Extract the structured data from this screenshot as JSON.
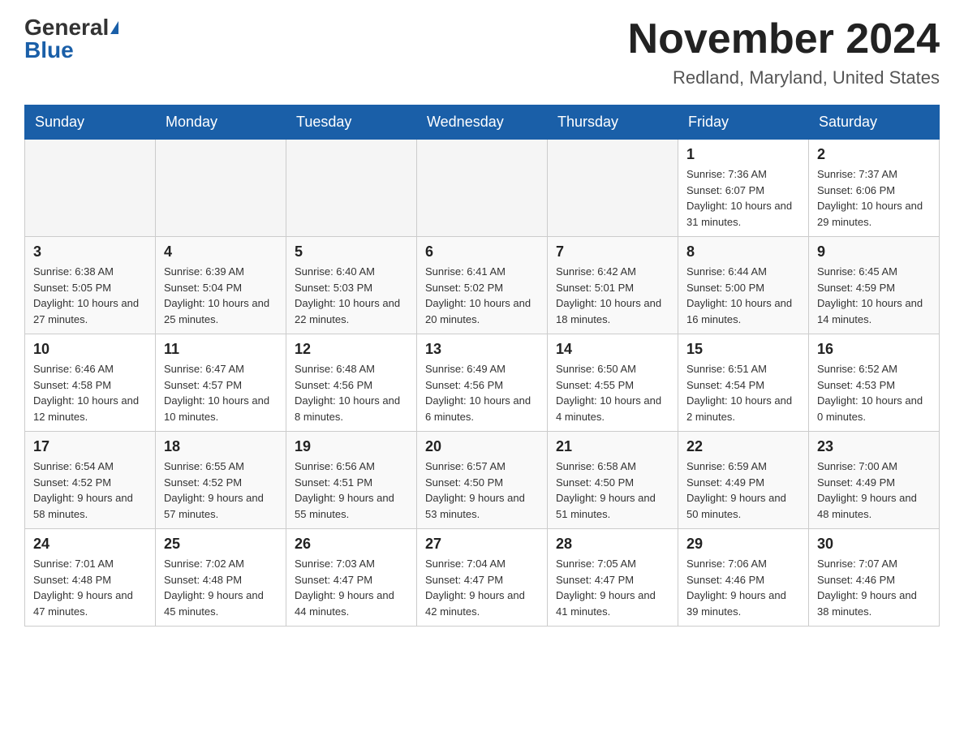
{
  "logo": {
    "general": "General",
    "blue": "Blue"
  },
  "title": "November 2024",
  "subtitle": "Redland, Maryland, United States",
  "days_of_week": [
    "Sunday",
    "Monday",
    "Tuesday",
    "Wednesday",
    "Thursday",
    "Friday",
    "Saturday"
  ],
  "weeks": [
    [
      {
        "day": "",
        "info": ""
      },
      {
        "day": "",
        "info": ""
      },
      {
        "day": "",
        "info": ""
      },
      {
        "day": "",
        "info": ""
      },
      {
        "day": "",
        "info": ""
      },
      {
        "day": "1",
        "info": "Sunrise: 7:36 AM\nSunset: 6:07 PM\nDaylight: 10 hours and 31 minutes."
      },
      {
        "day": "2",
        "info": "Sunrise: 7:37 AM\nSunset: 6:06 PM\nDaylight: 10 hours and 29 minutes."
      }
    ],
    [
      {
        "day": "3",
        "info": "Sunrise: 6:38 AM\nSunset: 5:05 PM\nDaylight: 10 hours and 27 minutes."
      },
      {
        "day": "4",
        "info": "Sunrise: 6:39 AM\nSunset: 5:04 PM\nDaylight: 10 hours and 25 minutes."
      },
      {
        "day": "5",
        "info": "Sunrise: 6:40 AM\nSunset: 5:03 PM\nDaylight: 10 hours and 22 minutes."
      },
      {
        "day": "6",
        "info": "Sunrise: 6:41 AM\nSunset: 5:02 PM\nDaylight: 10 hours and 20 minutes."
      },
      {
        "day": "7",
        "info": "Sunrise: 6:42 AM\nSunset: 5:01 PM\nDaylight: 10 hours and 18 minutes."
      },
      {
        "day": "8",
        "info": "Sunrise: 6:44 AM\nSunset: 5:00 PM\nDaylight: 10 hours and 16 minutes."
      },
      {
        "day": "9",
        "info": "Sunrise: 6:45 AM\nSunset: 4:59 PM\nDaylight: 10 hours and 14 minutes."
      }
    ],
    [
      {
        "day": "10",
        "info": "Sunrise: 6:46 AM\nSunset: 4:58 PM\nDaylight: 10 hours and 12 minutes."
      },
      {
        "day": "11",
        "info": "Sunrise: 6:47 AM\nSunset: 4:57 PM\nDaylight: 10 hours and 10 minutes."
      },
      {
        "day": "12",
        "info": "Sunrise: 6:48 AM\nSunset: 4:56 PM\nDaylight: 10 hours and 8 minutes."
      },
      {
        "day": "13",
        "info": "Sunrise: 6:49 AM\nSunset: 4:56 PM\nDaylight: 10 hours and 6 minutes."
      },
      {
        "day": "14",
        "info": "Sunrise: 6:50 AM\nSunset: 4:55 PM\nDaylight: 10 hours and 4 minutes."
      },
      {
        "day": "15",
        "info": "Sunrise: 6:51 AM\nSunset: 4:54 PM\nDaylight: 10 hours and 2 minutes."
      },
      {
        "day": "16",
        "info": "Sunrise: 6:52 AM\nSunset: 4:53 PM\nDaylight: 10 hours and 0 minutes."
      }
    ],
    [
      {
        "day": "17",
        "info": "Sunrise: 6:54 AM\nSunset: 4:52 PM\nDaylight: 9 hours and 58 minutes."
      },
      {
        "day": "18",
        "info": "Sunrise: 6:55 AM\nSunset: 4:52 PM\nDaylight: 9 hours and 57 minutes."
      },
      {
        "day": "19",
        "info": "Sunrise: 6:56 AM\nSunset: 4:51 PM\nDaylight: 9 hours and 55 minutes."
      },
      {
        "day": "20",
        "info": "Sunrise: 6:57 AM\nSunset: 4:50 PM\nDaylight: 9 hours and 53 minutes."
      },
      {
        "day": "21",
        "info": "Sunrise: 6:58 AM\nSunset: 4:50 PM\nDaylight: 9 hours and 51 minutes."
      },
      {
        "day": "22",
        "info": "Sunrise: 6:59 AM\nSunset: 4:49 PM\nDaylight: 9 hours and 50 minutes."
      },
      {
        "day": "23",
        "info": "Sunrise: 7:00 AM\nSunset: 4:49 PM\nDaylight: 9 hours and 48 minutes."
      }
    ],
    [
      {
        "day": "24",
        "info": "Sunrise: 7:01 AM\nSunset: 4:48 PM\nDaylight: 9 hours and 47 minutes."
      },
      {
        "day": "25",
        "info": "Sunrise: 7:02 AM\nSunset: 4:48 PM\nDaylight: 9 hours and 45 minutes."
      },
      {
        "day": "26",
        "info": "Sunrise: 7:03 AM\nSunset: 4:47 PM\nDaylight: 9 hours and 44 minutes."
      },
      {
        "day": "27",
        "info": "Sunrise: 7:04 AM\nSunset: 4:47 PM\nDaylight: 9 hours and 42 minutes."
      },
      {
        "day": "28",
        "info": "Sunrise: 7:05 AM\nSunset: 4:47 PM\nDaylight: 9 hours and 41 minutes."
      },
      {
        "day": "29",
        "info": "Sunrise: 7:06 AM\nSunset: 4:46 PM\nDaylight: 9 hours and 39 minutes."
      },
      {
        "day": "30",
        "info": "Sunrise: 7:07 AM\nSunset: 4:46 PM\nDaylight: 9 hours and 38 minutes."
      }
    ]
  ]
}
